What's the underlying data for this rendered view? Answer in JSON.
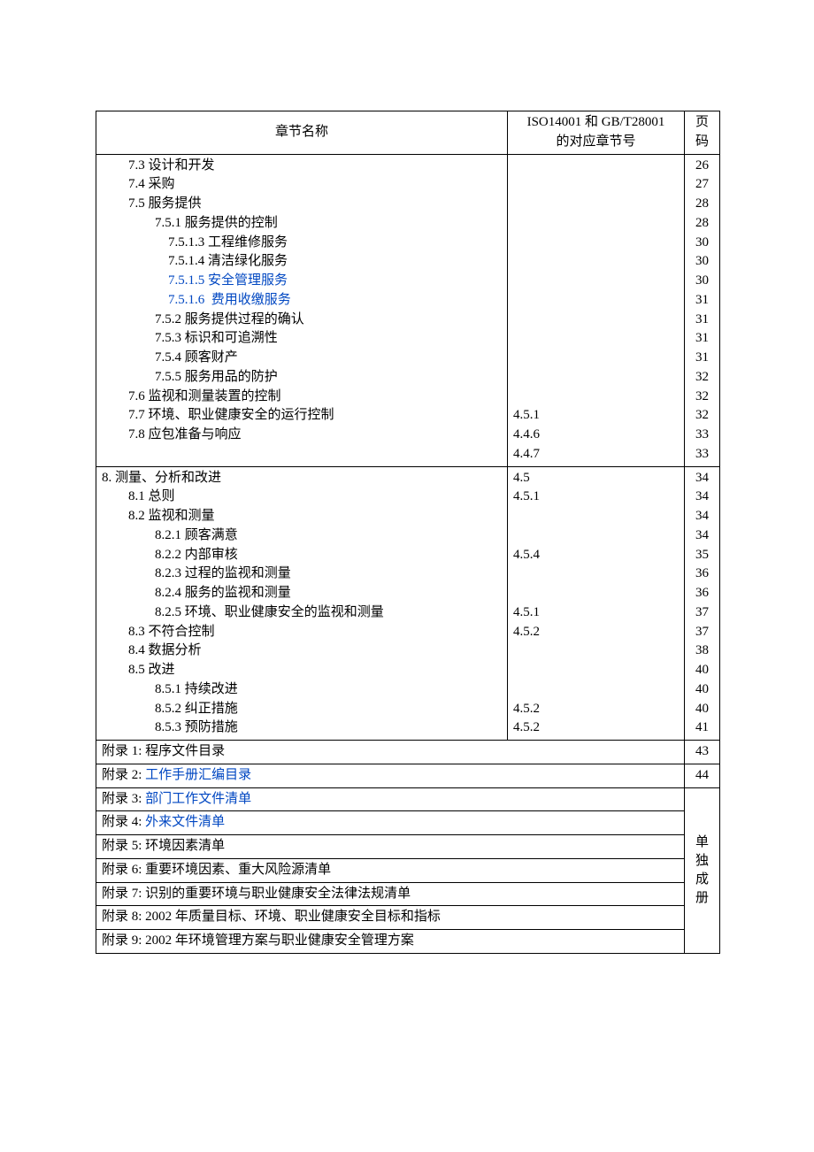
{
  "header": {
    "col1": "章节名称",
    "col2_line1": "ISO14001 和 GB/T28001",
    "col2_line2": "的对应章节号",
    "col3_line1": "页",
    "col3_line2": "码"
  },
  "block1": [
    {
      "indent": 1,
      "text": "7.3 设计和开发",
      "chap": "",
      "page": "26"
    },
    {
      "indent": 1,
      "text": "7.4 采购",
      "chap": "",
      "page": "27"
    },
    {
      "indent": 1,
      "text": "7.5 服务提供",
      "chap": "",
      "page": "28"
    },
    {
      "indent": 2,
      "text": "7.5.1 服务提供的控制",
      "chap": "",
      "page": "28"
    },
    {
      "indent": 3,
      "text": "7.5.1.3 工程维修服务",
      "chap": "",
      "page": "30"
    },
    {
      "indent": 3,
      "text": "7.5.1.4 清洁绿化服务",
      "chap": "",
      "page": "30"
    },
    {
      "indent": 3,
      "text": "7.5.1.5 安全管理服务",
      "chap": "",
      "page": "30",
      "blue": true
    },
    {
      "indent": 3,
      "text": "7.5.1.6  费用收缴服务",
      "chap": "",
      "page": "31",
      "blue": true
    },
    {
      "indent": 2,
      "text": "7.5.2 服务提供过程的确认",
      "chap": "",
      "page": "31"
    },
    {
      "indent": 2,
      "text": "7.5.3 标识和可追溯性",
      "chap": "",
      "page": "31"
    },
    {
      "indent": 2,
      "text": "7.5.4 顾客财产",
      "chap": "",
      "page": "31"
    },
    {
      "indent": 2,
      "text": "7.5.5 服务用品的防护",
      "chap": "",
      "page": "32"
    },
    {
      "indent": 1,
      "text": "7.6 监视和测量装置的控制",
      "chap": "",
      "page": "32"
    },
    {
      "indent": 1,
      "text": "7.7 环境、职业健康安全的运行控制",
      "chap": "4.5.1",
      "page": "32"
    },
    {
      "indent": 1,
      "text": "7.8 应包准备与响应",
      "chap": "4.4.6",
      "page": "33"
    },
    {
      "indent": 1,
      "text": "",
      "chap": "4.4.7",
      "page": "33"
    }
  ],
  "block2": [
    {
      "indent": 0,
      "text": "8. 测量、分析和改进",
      "chap": "4.5",
      "page": "34"
    },
    {
      "indent": 1,
      "text": "8.1 总则",
      "chap": "4.5.1",
      "page": "34"
    },
    {
      "indent": 1,
      "text": "8.2 监视和测量",
      "chap": "",
      "page": "34"
    },
    {
      "indent": 2,
      "text": "8.2.1 顾客满意",
      "chap": "",
      "page": "34"
    },
    {
      "indent": 2,
      "text": "8.2.2 内部审核",
      "chap": "4.5.4",
      "page": "35"
    },
    {
      "indent": 2,
      "text": "8.2.3 过程的监视和测量",
      "chap": "",
      "page": "36"
    },
    {
      "indent": 2,
      "text": "8.2.4 服务的监视和测量",
      "chap": "",
      "page": "36"
    },
    {
      "indent": 2,
      "text": "8.2.5 环境、职业健康安全的监视和测量",
      "chap": "4.5.1",
      "page": "37"
    },
    {
      "indent": 1,
      "text": "8.3 不符合控制",
      "chap": "4.5.2",
      "page": "37"
    },
    {
      "indent": 1,
      "text": "8.4 数据分析",
      "chap": "",
      "page": "38"
    },
    {
      "indent": 1,
      "text": "8.5 改进",
      "chap": "",
      "page": "40"
    },
    {
      "indent": 2,
      "text": "8.5.1 持续改进",
      "chap": "",
      "page": "40"
    },
    {
      "indent": 2,
      "text": "8.5.2 纠正措施",
      "chap": "4.5.2",
      "page": "40"
    },
    {
      "indent": 2,
      "text": "8.5.3 预防措施",
      "chap": "4.5.2",
      "page": "41"
    }
  ],
  "appendix_plain": [
    {
      "label": "附录 1:",
      "title": " 程序文件目录",
      "page": "43"
    },
    {
      "label": "附录 2:",
      "title": " 工作手册汇编目录",
      "blue": true,
      "page": "44"
    }
  ],
  "appendix_booklet": [
    {
      "label": "附录 3:",
      "title": " 部门工作文件清单",
      "blue": true
    },
    {
      "label": "附录 4:",
      "title": " 外来文件清单",
      "blue": true
    },
    {
      "label": "附录 5:",
      "title": " 环境因素清单"
    },
    {
      "label": "附录 6:",
      "title": " 重要环境因素、重大风险源清单"
    },
    {
      "label": "附录 7:",
      "title": " 识别的重要环境与职业健康安全法律法规清单"
    },
    {
      "label": "附录 8:",
      "title": " 2002 年质量目标、环境、职业健康安全目标和指标"
    },
    {
      "label": "附录 9:",
      "title": " 2002 年环境管理方案与职业健康安全管理方案"
    }
  ],
  "booklet_note": "单独成册"
}
